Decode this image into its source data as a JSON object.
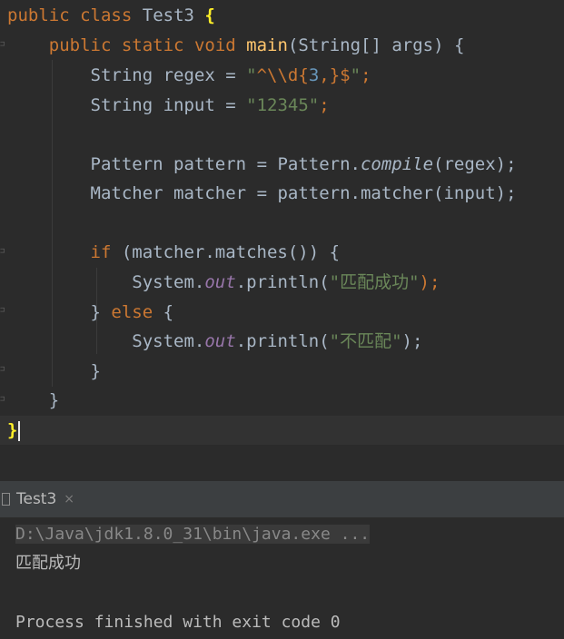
{
  "code_lines": [
    {
      "line": 1,
      "text": "public class Test3 {"
    },
    {
      "line": 2,
      "text": "    public static void main(String[] args) {"
    },
    {
      "line": 3,
      "text": "        String regex = \"^\\\\d{3,}$\";"
    },
    {
      "line": 4,
      "text": "        String input = \"12345\";"
    },
    {
      "line": 5,
      "text": ""
    },
    {
      "line": 6,
      "text": "        Pattern pattern = Pattern.compile(regex);"
    },
    {
      "line": 7,
      "text": "        Matcher matcher = pattern.matcher(input);"
    },
    {
      "line": 8,
      "text": ""
    },
    {
      "line": 9,
      "text": "        if (matcher.matches()) {"
    },
    {
      "line": 10,
      "text": "            System.out.println(\"匹配成功\");"
    },
    {
      "line": 11,
      "text": "        } else {"
    },
    {
      "line": 12,
      "text": "            System.out.println(\"不匹配\");"
    },
    {
      "line": 13,
      "text": "        }"
    },
    {
      "line": 14,
      "text": "    }"
    },
    {
      "line": 15,
      "text": "}"
    }
  ],
  "tokens": {
    "kw_public": "public",
    "kw_class": "class",
    "class_name": "Test3",
    "brace_open": "{",
    "kw_static": "static",
    "kw_void": "void",
    "fn_main": "main",
    "params": "(String[] args) {",
    "type_string": "String",
    "var_regex": "regex",
    "eq": " = ",
    "regex_q1": "\"",
    "regex_caret": "^",
    "regex_esc": "\\\\d",
    "regex_brace": "{",
    "regex_num": "3",
    "regex_comma": ",",
    "regex_close": "}$",
    "regex_q2": "\"",
    "semicolon": ";",
    "var_input": "input",
    "str_input": "\"12345\"",
    "type_pattern": "Pattern",
    "var_pattern": "pattern",
    "compile_prefix": "Pattern.",
    "compile": "compile",
    "compile_args": "(regex);",
    "type_matcher": "Matcher",
    "var_matcher": "matcher",
    "matcher_call": "pattern.matcher(input);",
    "kw_if": "if",
    "if_cond": " (matcher.matches()) {",
    "system": "System.",
    "out": "out",
    "println": ".println(",
    "str_success": "\"匹配成功\"",
    "str_fail": "\"不匹配\"",
    "call_end": ");",
    "close_brace": "}",
    "kw_else": "else",
    "else_open": " {"
  },
  "run_panel": {
    "tab_label": "Test3",
    "close_glyph": "×",
    "command": "D:\\Java\\jdk1.8.0_31\\bin\\java.exe ...",
    "output": "匹配成功",
    "exit_message": "Process finished with exit code 0"
  },
  "colors": {
    "background": "#2b2b2b",
    "keyword": "#cc7832",
    "string": "#6a8759",
    "number": "#6897bb",
    "method": "#ffc66d",
    "field": "#9876aa",
    "text": "#a9b7c6"
  }
}
